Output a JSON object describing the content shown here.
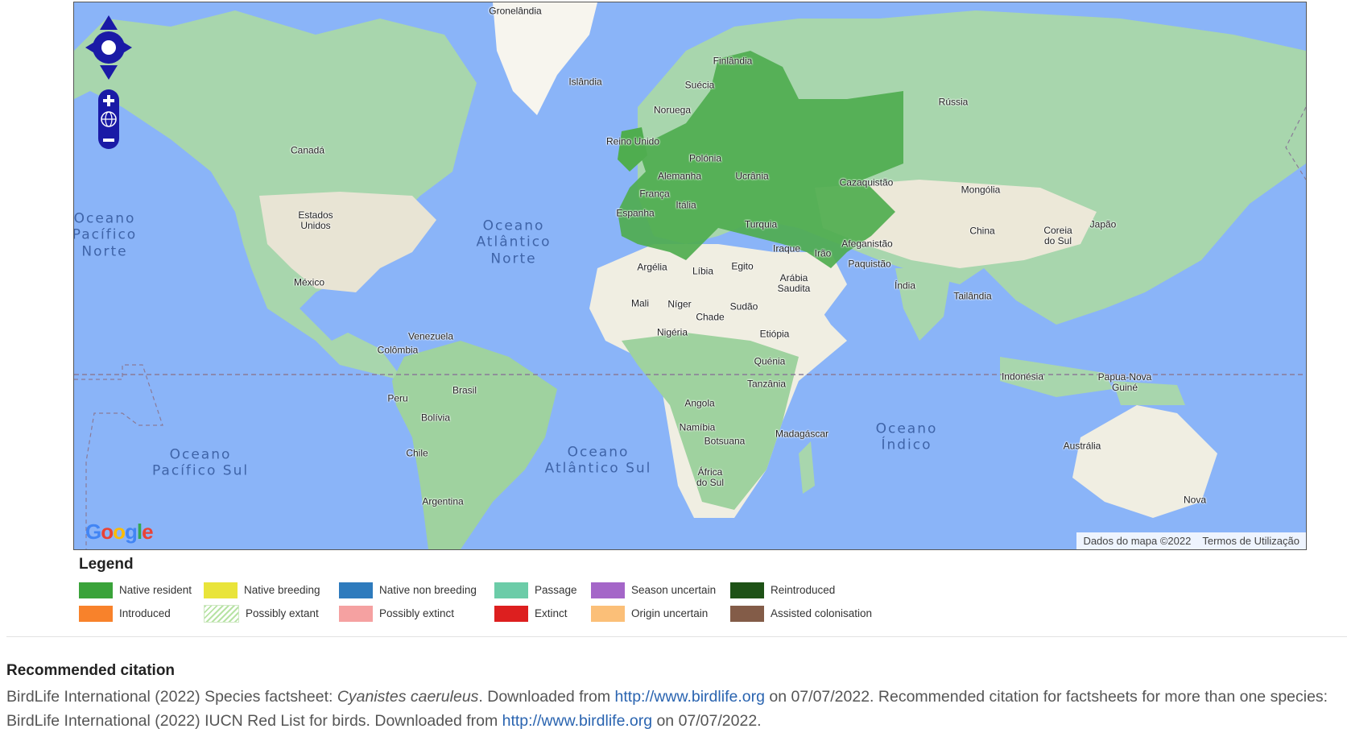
{
  "map": {
    "countries": [
      {
        "id": "gronelandia",
        "label": "Gronelândia"
      },
      {
        "id": "islandia",
        "label": "Islândia"
      },
      {
        "id": "finlandia",
        "label": "Finlândia"
      },
      {
        "id": "suecia",
        "label": "Suécia"
      },
      {
        "id": "noruega",
        "label": "Noruega"
      },
      {
        "id": "russia",
        "label": "Rússia"
      },
      {
        "id": "reino-unido",
        "label": "Reino Unido"
      },
      {
        "id": "polonia",
        "label": "Polónia"
      },
      {
        "id": "alemanha",
        "label": "Alemanha"
      },
      {
        "id": "ucrania",
        "label": "Ucrânia"
      },
      {
        "id": "franca",
        "label": "França"
      },
      {
        "id": "espanha",
        "label": "Espanha"
      },
      {
        "id": "italia",
        "label": "Itália"
      },
      {
        "id": "turquia",
        "label": "Turquia"
      },
      {
        "id": "cazaquistao",
        "label": "Cazaquistão"
      },
      {
        "id": "mongolia",
        "label": "Mongólia"
      },
      {
        "id": "canada",
        "label": "Canadá"
      },
      {
        "id": "estados-unidos",
        "label": "Estados\nUnidos"
      },
      {
        "id": "mexico",
        "label": "México"
      },
      {
        "id": "iraque",
        "label": "Iraque"
      },
      {
        "id": "irao",
        "label": "Irão"
      },
      {
        "id": "afeganistao",
        "label": "Afeganistão"
      },
      {
        "id": "paquistao",
        "label": "Paquistão"
      },
      {
        "id": "china",
        "label": "China"
      },
      {
        "id": "coreia-do-sul",
        "label": "Coreia\ndo Sul"
      },
      {
        "id": "japao",
        "label": "Japão"
      },
      {
        "id": "argelia",
        "label": "Argélia"
      },
      {
        "id": "libia",
        "label": "Líbia"
      },
      {
        "id": "egito",
        "label": "Egito"
      },
      {
        "id": "arabia-saudita",
        "label": "Arábia\nSaudita"
      },
      {
        "id": "india",
        "label": "Índia"
      },
      {
        "id": "tailandia",
        "label": "Tailândia"
      },
      {
        "id": "mali",
        "label": "Mali"
      },
      {
        "id": "niger",
        "label": "Níger"
      },
      {
        "id": "chade",
        "label": "Chade"
      },
      {
        "id": "sudao",
        "label": "Sudão"
      },
      {
        "id": "nigeria",
        "label": "Nigéria"
      },
      {
        "id": "etiopia",
        "label": "Etiópia"
      },
      {
        "id": "venezuela",
        "label": "Venezuela"
      },
      {
        "id": "colombia",
        "label": "Colômbia"
      },
      {
        "id": "quenia",
        "label": "Quénia"
      },
      {
        "id": "tanzania",
        "label": "Tanzânia"
      },
      {
        "id": "indonesia",
        "label": "Indonésia"
      },
      {
        "id": "papua-nova-guine",
        "label": "Papua-Nova\nGuiné"
      },
      {
        "id": "brasil",
        "label": "Brasil"
      },
      {
        "id": "peru",
        "label": "Peru"
      },
      {
        "id": "bolivia",
        "label": "Bolívia"
      },
      {
        "id": "angola",
        "label": "Angola"
      },
      {
        "id": "namibia",
        "label": "Namíbia"
      },
      {
        "id": "botsuana",
        "label": "Botsuana"
      },
      {
        "id": "madagascar",
        "label": "Madagáscar"
      },
      {
        "id": "australia",
        "label": "Austrália"
      },
      {
        "id": "chile",
        "label": "Chile"
      },
      {
        "id": "africa-do-sul",
        "label": "África\ndo Sul"
      },
      {
        "id": "argentina",
        "label": "Argentina"
      },
      {
        "id": "nova",
        "label": "Nova"
      }
    ],
    "oceans": [
      {
        "id": "pacifico-norte",
        "label": "Oceano\nPacífico\nNorte"
      },
      {
        "id": "atlantico-norte",
        "label": "Oceano\nAtlântico\nNorte"
      },
      {
        "id": "pacifico-sul",
        "label": "Oceano\nPacífico Sul"
      },
      {
        "id": "atlantico-sul",
        "label": "Oceano\nAtlântico Sul"
      },
      {
        "id": "indico",
        "label": "Oceano\nÍndico"
      }
    ],
    "google_logo": [
      "G",
      "o",
      "o",
      "g",
      "l",
      "e"
    ],
    "attribution": {
      "data": "Dados do mapa ©2022",
      "terms": "Termos de Utilização"
    }
  },
  "legend": {
    "title": "Legend",
    "items": [
      {
        "id": "native-resident",
        "label": "Native resident",
        "color": "#3aa33a"
      },
      {
        "id": "native-breeding",
        "label": "Native breeding",
        "color": "#e9e43a"
      },
      {
        "id": "native-non-breeding",
        "label": "Native non breeding",
        "color": "#2e7bbd"
      },
      {
        "id": "passage",
        "label": "Passage",
        "color": "#6ccca8"
      },
      {
        "id": "season-uncertain",
        "label": "Season uncertain",
        "color": "#a466c8"
      },
      {
        "id": "reintroduced",
        "label": "Reintroduced",
        "color": "#1e5216"
      },
      {
        "id": "introduced",
        "label": "Introduced",
        "color": "#f8822b"
      },
      {
        "id": "possibly-extant",
        "label": "Possibly extant",
        "color": "#b7e3a4"
      },
      {
        "id": "possibly-extinct",
        "label": "Possibly extinct",
        "color": "#f5a1a1"
      },
      {
        "id": "extinct",
        "label": "Extinct",
        "color": "#dd1f1f"
      },
      {
        "id": "origin-uncertain",
        "label": "Origin uncertain",
        "color": "#fbbf78"
      },
      {
        "id": "assisted-colonisation",
        "label": "Assisted colonisation",
        "color": "#835c48"
      }
    ]
  },
  "citation": {
    "heading": "Recommended citation",
    "part1": "BirdLife International (2022) Species factsheet: ",
    "species": "Cyanistes caeruleus",
    "part2": ". Downloaded from ",
    "link1": "http://www.birdlife.org",
    "part3": " on 07/07/2022. Recommended citation for factsheets for more than one species: BirdLife International (2022) IUCN Red List for birds. Downloaded from ",
    "link2": "http://www.birdlife.org",
    "part4": " on 07/07/2022."
  }
}
